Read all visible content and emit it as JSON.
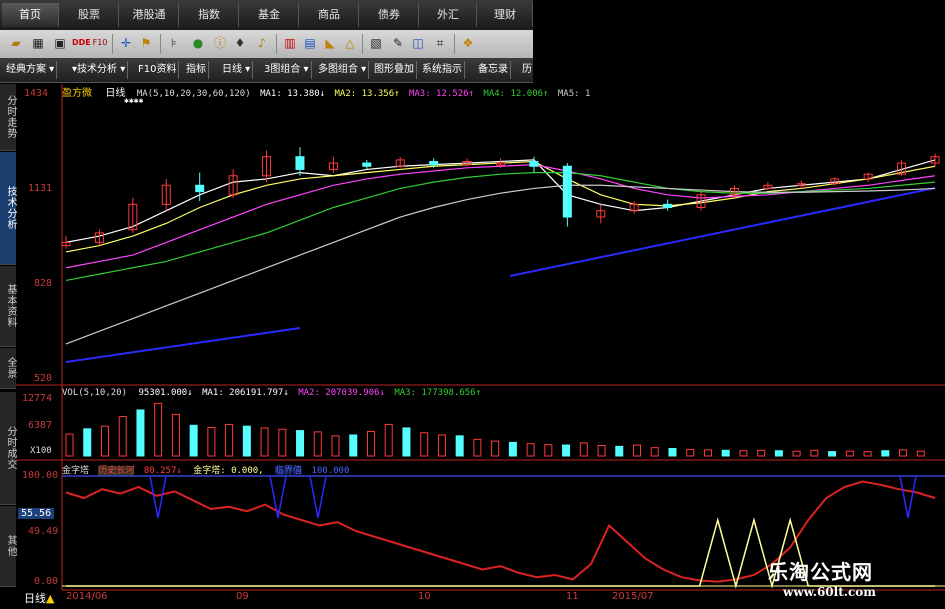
{
  "top_nav": [
    "首页",
    "股票",
    "港股通",
    "指数",
    "基金",
    "商品",
    "债券",
    "外汇",
    "理财"
  ],
  "toolbar_icons": [
    "folder-icon",
    "grid-icon",
    "image-icon",
    "dde-icon",
    "f10-icon",
    "cross-icon",
    "flag-icon",
    "scale-icon",
    "color-icon",
    "info-icon",
    "bell-icon",
    "chart-icon",
    "settings-icon",
    "ruler-icon",
    "triangle-icon",
    "calc-icon",
    "pen-icon",
    "screen-icon",
    "help-icon"
  ],
  "func_bar": [
    "经典方案",
    "技术分析",
    "F10资料",
    "指标",
    "日线",
    "3图组合",
    "多图组合",
    "图形叠加",
    "系统指示",
    "备忘录",
    "历"
  ],
  "side_tabs": [
    "分时走势",
    "技术分析",
    "基本资料",
    "全景",
    "分时成交",
    "其他"
  ],
  "main_panel": {
    "title": "盈方微",
    "period": "日线",
    "ma_legend": "MA(5,10,20,30,60,120)",
    "ma1": "MA1: 13.380↓",
    "ma2": "MA2: 13.356↑",
    "ma3": "MA3: 12.526↑",
    "ma4": "MA4: 12.006↑",
    "ma5": "MA5: 1",
    "y_ticks": [
      "1434",
      "1131",
      "828",
      "520"
    ]
  },
  "vol_panel": {
    "legend": "VOL(5,10,20)",
    "vol": "95301.000↓",
    "ma1": "MA1: 206191.797↓",
    "ma2": "MA2: 207039.906↓",
    "ma3": "MA3: 177398.656↑",
    "y_ticks": [
      "12774",
      "6387",
      "X100"
    ]
  },
  "ind_panel": {
    "legend": "金字塔",
    "tag1": "历史长河",
    "val1": "80.257↓",
    "label2": "金字塔: 0.000,",
    "tag2": "临界值",
    "val2": "100.000",
    "y_ticks": [
      "100.00",
      "55.56",
      "49.49",
      "0.00"
    ]
  },
  "x_axis": [
    "2014/06",
    "09",
    "10",
    "11",
    "2015/07"
  ],
  "bottom_label": "日线",
  "watermark": {
    "name": "乐淘公式网",
    "url": "www.60lt.com"
  },
  "colors": {
    "up": "#ff3b3b",
    "down": "#54ffff",
    "ma1": "#ffffff",
    "ma2": "#ffff66",
    "ma3": "#ff44ff",
    "ma4": "#33cc33",
    "ma5": "#cccccc",
    "trend": "#2a2aff",
    "signal": "#ffff99",
    "ind_line": "#dd2222"
  },
  "chart_data": [
    {
      "type": "candlestick",
      "title": "盈方微 日线",
      "ylim": [
        520,
        1434
      ],
      "series": [
        {
          "name": "MA1",
          "values": [
            960,
            980,
            1010,
            1060,
            1110,
            1150,
            1160,
            1180,
            1170,
            1190,
            1200,
            1205,
            1210,
            1215,
            1220,
            1110,
            1080,
            1060,
            1070,
            1090,
            1110,
            1130,
            1140,
            1150,
            1160,
            1190,
            1220
          ]
        },
        {
          "name": "MA2",
          "values": [
            930,
            950,
            980,
            1020,
            1070,
            1110,
            1140,
            1160,
            1170,
            1180,
            1190,
            1200,
            1205,
            1210,
            1215,
            1160,
            1110,
            1080,
            1075,
            1085,
            1100,
            1120,
            1130,
            1145,
            1160,
            1180,
            1200
          ]
        },
        {
          "name": "MA3",
          "values": [
            880,
            900,
            920,
            960,
            1000,
            1040,
            1080,
            1110,
            1140,
            1160,
            1175,
            1185,
            1195,
            1200,
            1205,
            1185,
            1160,
            1130,
            1110,
            1100,
            1105,
            1110,
            1120,
            1130,
            1140,
            1155,
            1170
          ]
        },
        {
          "name": "MA4",
          "values": [
            840,
            860,
            880,
            900,
            930,
            960,
            990,
            1030,
            1070,
            1100,
            1130,
            1150,
            1165,
            1175,
            1180,
            1180,
            1170,
            1150,
            1130,
            1120,
            1115,
            1115,
            1120,
            1125,
            1130,
            1140,
            1150
          ]
        },
        {
          "name": "MA5",
          "values": [
            640,
            680,
            720,
            760,
            800,
            840,
            880,
            920,
            960,
            1000,
            1040,
            1070,
            1095,
            1115,
            1130,
            1140,
            1140,
            1135,
            1130,
            1125,
            1120,
            1118,
            1118,
            1120,
            1122,
            1125,
            1130
          ]
        }
      ],
      "candles": [
        [
          950,
          960,
          940,
          980
        ],
        [
          960,
          990,
          950,
          1000
        ],
        [
          1000,
          1080,
          990,
          1100
        ],
        [
          1080,
          1140,
          1060,
          1160
        ],
        [
          1140,
          1120,
          1090,
          1180
        ],
        [
          1110,
          1170,
          1100,
          1190
        ],
        [
          1170,
          1230,
          1150,
          1250
        ],
        [
          1230,
          1190,
          1170,
          1260
        ],
        [
          1190,
          1210,
          1180,
          1230
        ],
        [
          1210,
          1200,
          1190,
          1220
        ],
        [
          1200,
          1220,
          1195,
          1230
        ],
        [
          1215,
          1205,
          1195,
          1225
        ],
        [
          1205,
          1215,
          1200,
          1225
        ],
        [
          1210,
          1210,
          1195,
          1225
        ],
        [
          1215,
          1200,
          1180,
          1230
        ],
        [
          1200,
          1040,
          1010,
          1210
        ],
        [
          1040,
          1060,
          1020,
          1080
        ],
        [
          1060,
          1080,
          1050,
          1090
        ],
        [
          1080,
          1070,
          1060,
          1095
        ],
        [
          1070,
          1110,
          1060,
          1120
        ],
        [
          1110,
          1130,
          1100,
          1140
        ],
        [
          1130,
          1140,
          1125,
          1150
        ],
        [
          1140,
          1145,
          1130,
          1155
        ],
        [
          1145,
          1160,
          1140,
          1165
        ],
        [
          1160,
          1175,
          1150,
          1180
        ],
        [
          1175,
          1210,
          1170,
          1220
        ],
        [
          1210,
          1230,
          1200,
          1240
        ]
      ]
    },
    {
      "type": "bar",
      "title": "VOL(5,10,20)",
      "ylim": [
        0,
        12774
      ],
      "values": [
        5000,
        6200,
        6800,
        9000,
        10500,
        12000,
        9500,
        7000,
        6500,
        7200,
        6800,
        6400,
        6100,
        5800,
        5500,
        4600,
        4800,
        5600,
        7200,
        6400,
        5300,
        4800,
        4600,
        3800,
        3400,
        3100,
        2800,
        2600,
        2500,
        3000,
        2400,
        2200,
        2500,
        1900,
        1700,
        1500,
        1400,
        1300,
        1200,
        1300,
        1200,
        1100,
        1300,
        1000,
        1100,
        1000,
        1200,
        1400,
        1100
      ]
    },
    {
      "type": "line",
      "title": "金字塔",
      "ylim": [
        0,
        100
      ],
      "series": [
        {
          "name": "历史长河",
          "values": [
            85,
            80,
            88,
            84,
            90,
            82,
            86,
            78,
            70,
            72,
            68,
            74,
            65,
            60,
            55,
            58,
            50,
            45,
            40,
            35,
            30,
            25,
            20,
            15,
            18,
            12,
            8,
            10,
            6,
            20,
            55,
            40,
            25,
            15,
            8,
            5,
            4,
            6,
            10,
            20,
            35,
            60,
            80,
            90,
            95,
            92,
            88,
            85,
            80
          ]
        },
        {
          "name": "金字塔",
          "values": [
            0,
            0,
            0,
            0,
            0,
            0,
            0,
            0,
            0,
            0,
            0,
            0,
            0,
            0,
            0,
            0,
            0,
            0,
            0,
            0,
            0,
            0,
            0,
            0,
            0,
            0,
            0,
            0,
            0,
            0,
            0,
            0,
            0,
            0,
            0,
            0,
            60,
            0,
            60,
            0,
            60,
            0,
            0,
            0,
            0,
            0,
            0,
            0,
            0
          ]
        }
      ]
    }
  ]
}
